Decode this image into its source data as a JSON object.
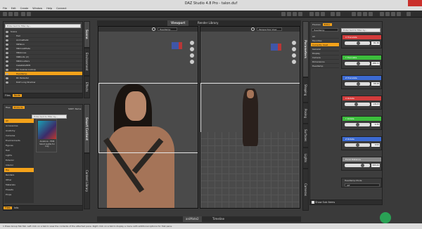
{
  "window": {
    "title": "DAZ Studio 4.8 Pro - talon.duf"
  },
  "menu": [
    "File",
    "Edit",
    "Create",
    "Window",
    "Help",
    "Connect",
    "Window",
    "Help"
  ],
  "scene": {
    "search_placeholder": "Enter text to filter by...",
    "rows": [
      {
        "label": "Scene",
        "sel": false
      },
      {
        "label": "Hair",
        "sel": false
      },
      {
        "label": "AnimePlaitz",
        "sel": false
      },
      {
        "label": "SNTalon",
        "sel": false
      },
      {
        "label": "SNCloakPlate",
        "sel": false
      },
      {
        "label": "SNGloves",
        "sel": false
      },
      {
        "label": "SNBoots (2)",
        "sel": false
      },
      {
        "label": "SNShoulders",
        "sel": false
      },
      {
        "label": "IrakefellaHD5",
        "sel": false
      },
      {
        "label": "RC Inverse Lookup",
        "sel": false
      },
      {
        "label": "Headlamp",
        "sel": true
      },
      {
        "label": "RC Pedestal",
        "sel": false
      },
      {
        "label": "DAZ Long Shadow",
        "sel": false
      }
    ],
    "tab_files": "Files",
    "tab_node": "Node",
    "side_tabs": [
      "Scene",
      "Environment",
      "Effects"
    ]
  },
  "products": {
    "tab_files": "Files",
    "tab_products": "Products",
    "search_placeholder": "Enter text to filter by...",
    "sort_label": "SORT: Name",
    "categories": [
      {
        "label": "All",
        "sel": true
      },
      {
        "label": "Accessories",
        "sel": false
      },
      {
        "label": "Anatomy",
        "sel": false
      },
      {
        "label": "Cameras",
        "sel": false
      },
      {
        "label": "Environments",
        "sel": false
      },
      {
        "label": "Figures",
        "sel": false
      },
      {
        "label": "Hair",
        "sel": false
      },
      {
        "label": "Lights",
        "sel": false
      },
      {
        "label": "Exterior",
        "sel": false
      },
      {
        "label": "Interior",
        "sel": false
      },
      {
        "label": "Hip",
        "sel": true
      },
      {
        "label": "Renders",
        "sel": false
      },
      {
        "label": "Other",
        "sel": false
      },
      {
        "label": "Materials",
        "sel": false
      },
      {
        "label": "Presets",
        "sel": false
      },
      {
        "label": "Props",
        "sel": false
      }
    ],
    "item_caption": "Anakova - HDR Skoot Lights for Iray",
    "bottom_left": "Files",
    "bottom_right": "Info",
    "side_tabs": [
      "Smart Content",
      "Content Library"
    ]
  },
  "viewports": {
    "tab_viewport": "Viewport",
    "tab_render": "Render Library",
    "left_camera": "Headlamp",
    "right_camera": "Perspective View"
  },
  "bottom_tabs": [
    "aniMate2",
    "Timeline"
  ],
  "parameters": {
    "tab_preview": "Preview",
    "tab_editor": "Editor",
    "header": "Headlamp",
    "search_placeholder": "Enter text to filter by...",
    "groups": [
      {
        "label": "All",
        "sel": false
      },
      {
        "label": "Favorites",
        "sel": false
      },
      {
        "label": "Currently Used",
        "sel": true
      },
      {
        "label": "General",
        "sel": false
      },
      {
        "label": "Display",
        "sel": false
      },
      {
        "label": "Camera",
        "sel": false
      },
      {
        "label": "Dimensions",
        "sel": false
      },
      {
        "label": "Headlamp",
        "sel": false
      }
    ],
    "sliders": [
      {
        "label": "X Translate",
        "value": "81.36",
        "fill": 0.55,
        "color": "#d23c3c"
      },
      {
        "label": "Y Translate",
        "value": "186.11",
        "fill": 0.55,
        "color": "#3cbd3c"
      },
      {
        "label": "Z Translate",
        "value": "68.48",
        "fill": 0.55,
        "color": "#3c6ad2"
      },
      {
        "label": "X Rotate",
        "value": "-18.23",
        "fill": 0.45,
        "color": "#d23c3c"
      },
      {
        "label": "Y Rotate",
        "value": "4.35",
        "fill": 0.5,
        "color": "#3cbd3c"
      },
      {
        "label": "Z Rotate",
        "value": "0.00",
        "fill": 0.5,
        "color": "#3c6ad2"
      },
      {
        "label": "Focal Distance",
        "value": "565.00",
        "fill": 0.7,
        "color": "#888888"
      }
    ],
    "headlamp_mode_label": "Headlamp Mode",
    "headlamp_mode_value": "Off",
    "show_sub_items": "Show Sub Items",
    "side_tabs": [
      "Parameters",
      "Shaping",
      "Posing",
      "Surfaces",
      "Lights",
      "Cameras"
    ]
  },
  "statusbar": {
    "text": "1 Press Group Tab Tab: Left click on a tab to view the contents of the attached pane. Right click on a tab to display a menu with additional options for that pane."
  }
}
